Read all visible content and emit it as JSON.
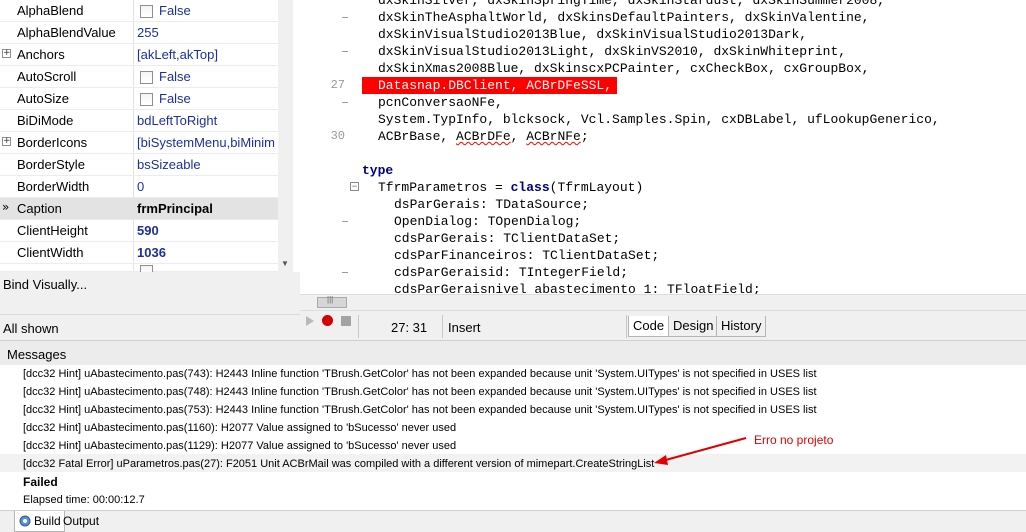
{
  "inspector": {
    "properties": [
      {
        "name": "AlphaBlend",
        "value": "False",
        "checkbox": true
      },
      {
        "name": "AlphaBlendValue",
        "value": "255"
      },
      {
        "name": "Anchors",
        "value": "[akLeft,akTop]",
        "expandable": true
      },
      {
        "name": "AutoScroll",
        "value": "False",
        "checkbox": true
      },
      {
        "name": "AutoSize",
        "value": "False",
        "checkbox": true
      },
      {
        "name": "BiDiMode",
        "value": "bdLeftToRight"
      },
      {
        "name": "BorderIcons",
        "value": "[biSystemMenu,biMinim",
        "expandable": true
      },
      {
        "name": "BorderStyle",
        "value": "bsSizeable"
      },
      {
        "name": "BorderWidth",
        "value": "0"
      },
      {
        "name": "Caption",
        "value": "frmPrincipal",
        "selected": true
      },
      {
        "name": "ClientHeight",
        "value": "590"
      },
      {
        "name": "ClientWidth",
        "value": "1036"
      }
    ],
    "bind_visually": "Bind Visually...",
    "all_shown": "All shown"
  },
  "editor": {
    "line_numbers": {
      "l27": "27",
      "l30": "30"
    },
    "lines": {
      "l0": "dxSkinSilver, dxSkinSpringTime, dxSkinStardust, dxSkinSummer2008,",
      "l1": "dxSkinTheAsphaltWorld, dxSkinsDefaultPainters, dxSkinValentine,",
      "l2": "dxSkinVisualStudio2013Blue, dxSkinVisualStudio2013Dark,",
      "l3": "dxSkinVisualStudio2013Light, dxSkinVS2010, dxSkinWhiteprint,",
      "l4": "dxSkinXmas2008Blue, dxSkinscxPCPainter, cxCheckBox, cxGroupBox,",
      "l5": "Datasnap.DBClient, ACBrDFeSSL,",
      "l6": "pcnConversaoNFe,",
      "l7": "System.TypInfo, blcksock, Vcl.Samples.Spin, cxDBLabel, ufLookupGenerico,",
      "l8_a": "ACBrBase, ",
      "l8_b": "ACBrDFe",
      "l8_c": ", ",
      "l8_d": "ACBrNFe",
      "l8_e": ";",
      "l10": "type",
      "l11_a": "TfrmParametros = ",
      "l11_kw": "class",
      "l11_b": "(TfrmLayout)",
      "l12": "dsParGerais: TDataSource;",
      "l13": "OpenDialog: TOpenDialog;",
      "l14": "cdsParGerais: TClientDataSet;",
      "l15": "cdsParFinanceiros: TClientDataSet;",
      "l16": "cdsParGeraisid: TIntegerField;",
      "l17": "cdsParGeraisnivel_abastecimento_1: TFloatField;"
    },
    "cursor_position": "27: 31",
    "insert_mode": "Insert",
    "tabs": [
      "Code",
      "Design",
      "History"
    ],
    "active_tab": "Code"
  },
  "messages": {
    "title": "Messages",
    "items": [
      "[dcc32 Hint] uAbastecimento.pas(743): H2443 Inline function 'TBrush.GetColor' has not been expanded because unit 'System.UITypes' is not specified in USES list",
      "[dcc32 Hint] uAbastecimento.pas(748): H2443 Inline function 'TBrush.GetColor' has not been expanded because unit 'System.UITypes' is not specified in USES list",
      "[dcc32 Hint] uAbastecimento.pas(753): H2443 Inline function 'TBrush.GetColor' has not been expanded because unit 'System.UITypes' is not specified in USES list",
      "[dcc32 Hint] uAbastecimento.pas(1160): H2077 Value assigned to 'bSucesso' never used",
      "[dcc32 Hint] uAbastecimento.pas(1129): H2077 Value assigned to 'bSucesso' never used",
      "[dcc32 Fatal Error] uParametros.pas(27): F2051 Unit ACBrMail was compiled with a different version of mimepart.CreateStringList"
    ],
    "status": "Failed",
    "elapsed": "Elapsed time: 00:00:12.7",
    "annotation": "Erro no projeto"
  },
  "bottom_tabs": [
    "Build",
    "Output"
  ],
  "colors": {
    "error_line": "#ff0000",
    "annotation": "#e00000",
    "value_blue": "#1c2fa0",
    "keyword": "#000080"
  }
}
